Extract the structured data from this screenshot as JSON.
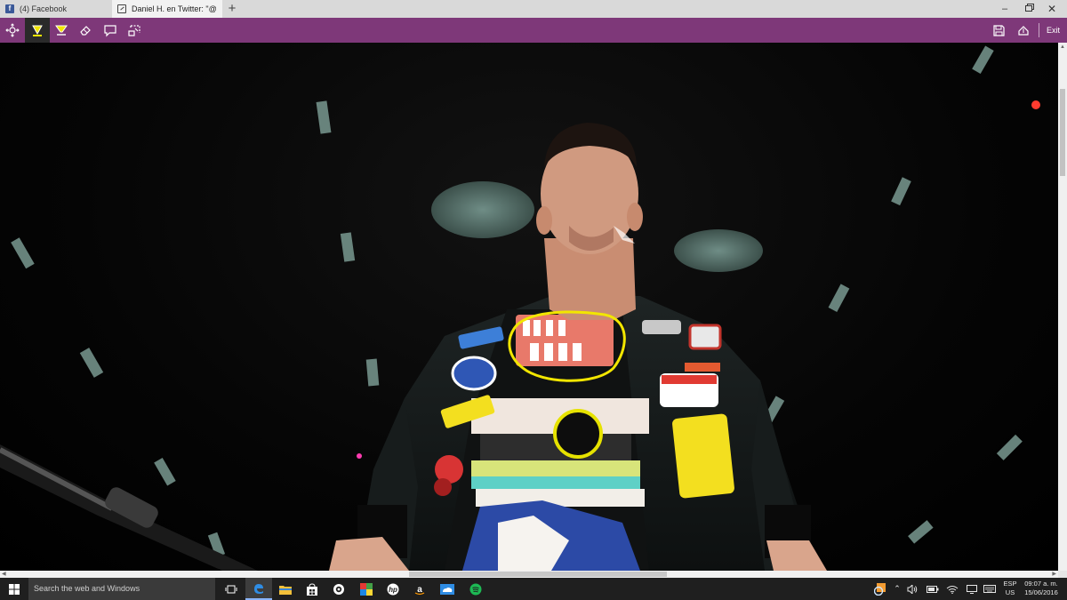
{
  "browser": {
    "tabs": [
      {
        "label": "(4) Facebook",
        "icon": "facebook-icon"
      },
      {
        "label": "Daniel H. en Twitter: \"@",
        "icon": "web-note-icon"
      }
    ],
    "new_tab_label": "+",
    "window_controls": {
      "minimize": "–",
      "close": "✕"
    }
  },
  "notes_toolbar": {
    "tools": [
      "pan-icon",
      "pen-icon",
      "highlighter-icon",
      "eraser-icon",
      "comment-icon",
      "clip-icon"
    ],
    "active_tool": "pen-icon",
    "right_tools": [
      "save-icon",
      "share-icon"
    ],
    "exit_label": "Exit",
    "accent_color": "#7e3879",
    "ink_color": "#f2e600"
  },
  "taskbar": {
    "search_placeholder": "Search the web and Windows",
    "pinned": [
      "task-view-icon",
      "edge-icon",
      "file-explorer-icon",
      "store-icon",
      "app-icon",
      "photos-icon",
      "hp-icon",
      "amazon-icon",
      "weather-icon",
      "spotify-icon"
    ],
    "active_app": "edge-icon",
    "tray": {
      "language_line1": "ESP",
      "language_line2": "US",
      "time": "09:07 a. m.",
      "date": "15/06/2016"
    }
  }
}
